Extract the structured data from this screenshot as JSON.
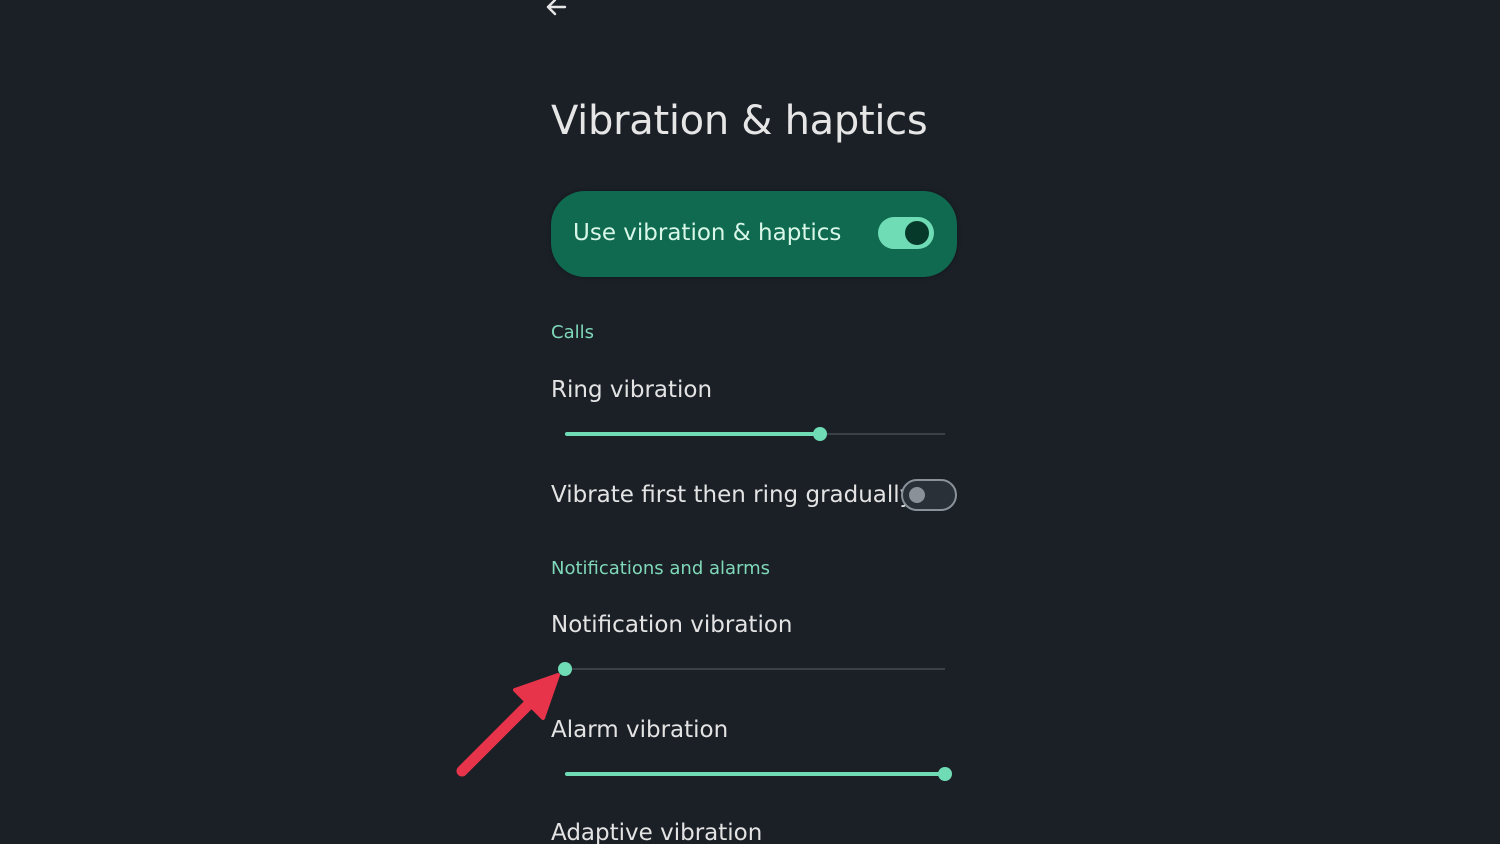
{
  "header": {
    "back_icon": "arrow-left-icon",
    "title": "Vibration & haptics"
  },
  "master_toggle": {
    "label": "Use vibration & haptics",
    "checked": true
  },
  "sections": {
    "calls": {
      "header": "Calls",
      "ring_vibration": {
        "label": "Ring vibration",
        "value": 0.67
      },
      "vibrate_first": {
        "label": "Vibrate first then ring gradually",
        "checked": false
      }
    },
    "notifications": {
      "header": "Notifications and alarms",
      "notification_vibration": {
        "label": "Notification vibration",
        "value": 0.0
      },
      "alarm_vibration": {
        "label": "Alarm vibration",
        "value": 1.0
      },
      "adaptive_vibration": {
        "label": "Adaptive vibration"
      }
    }
  },
  "annotation": {
    "icon": "red-arrow-icon",
    "color": "#e8344a"
  },
  "colors": {
    "background": "#1b2027",
    "accent": "#6fdcb5",
    "card": "#0f6a4f",
    "section_header": "#7fd8b8"
  }
}
